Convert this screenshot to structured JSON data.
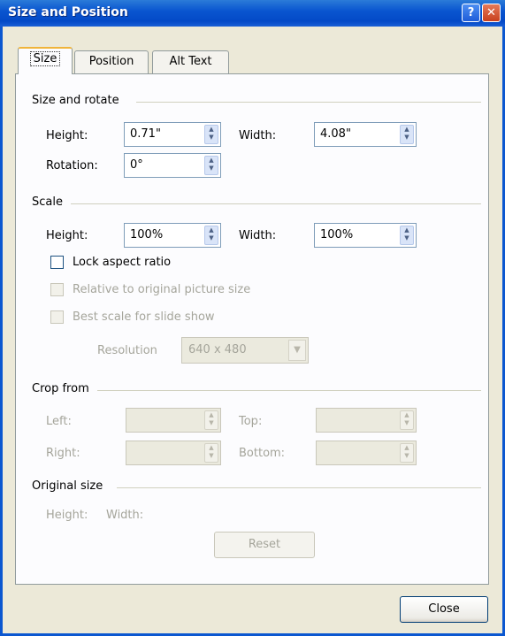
{
  "window": {
    "title": "Size and Position"
  },
  "tabs": [
    {
      "label": "Size"
    },
    {
      "label": "Position"
    },
    {
      "label": "Alt Text"
    }
  ],
  "size_rotate": {
    "heading": "Size and rotate",
    "height_label": "Height:",
    "height_value": "0.71\"",
    "width_label": "Width:",
    "width_value": "4.08\"",
    "rotation_label": "Rotation:",
    "rotation_value": "0°"
  },
  "scale": {
    "heading": "Scale",
    "height_label": "Height:",
    "height_value": "100%",
    "width_label": "Width:",
    "width_value": "100%",
    "lock_aspect": "Lock aspect ratio",
    "relative_original": "Relative to original picture size",
    "best_scale": "Best scale for slide show",
    "resolution_label": "Resolution",
    "resolution_value": "640 x 480"
  },
  "crop": {
    "heading": "Crop from",
    "left_label": "Left:",
    "top_label": "Top:",
    "right_label": "Right:",
    "bottom_label": "Bottom:"
  },
  "original": {
    "heading": "Original size",
    "height_label": "Height:",
    "width_label": "Width:",
    "reset_label": "Reset"
  },
  "footer": {
    "close_label": "Close"
  },
  "icons": {
    "help": "?",
    "close": "✕",
    "spin_up": "▲",
    "spin_down": "▼",
    "dropdown": "▼"
  }
}
